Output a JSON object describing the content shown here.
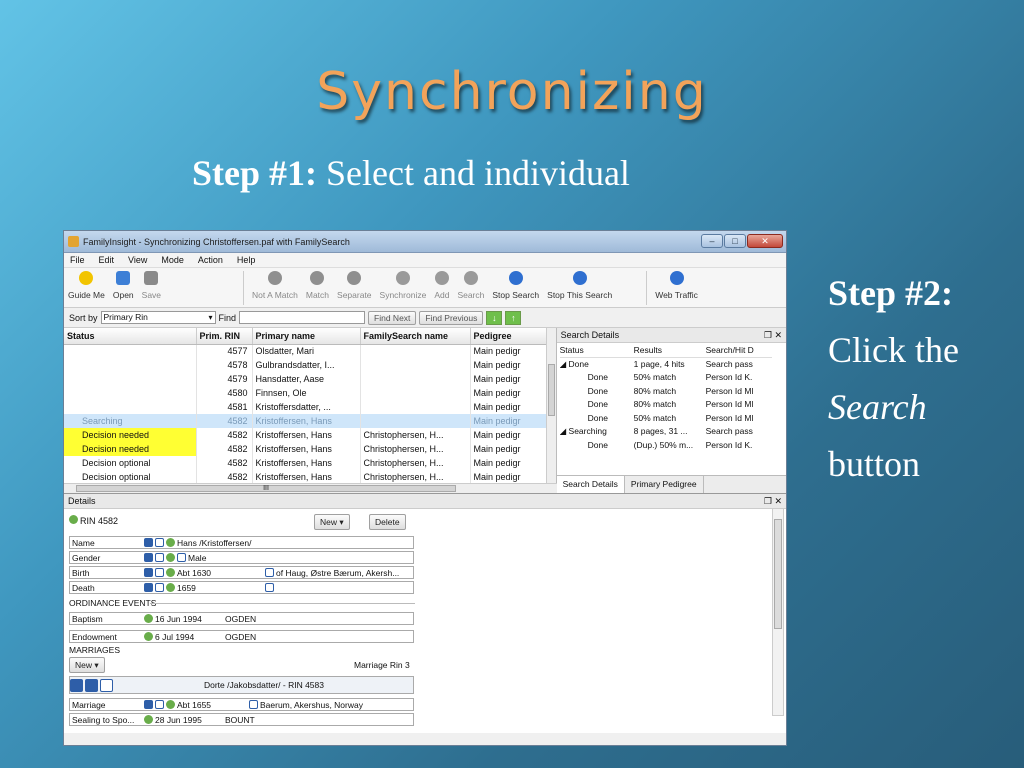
{
  "slide": {
    "title": "Synchronizing",
    "step1_bold": "Step #1:",
    "step1_text": " Select and individual",
    "step2_bold": "Step #2:",
    "step2_line1": "Click the",
    "step2_italic": "Search",
    "step2_line3": "button"
  },
  "window": {
    "title": "FamilyInsight - Synchronizing Christoffersen.paf with FamilySearch",
    "buttons": [
      "–",
      "□",
      "✕"
    ]
  },
  "menu": [
    "File",
    "Edit",
    "View",
    "Mode",
    "Action",
    "Help"
  ],
  "toolbar": {
    "group1": [
      {
        "label": "Guide Me",
        "icon": "lightbulb-icon",
        "color": "#f2c400"
      },
      {
        "label": "Open",
        "icon": "folder-icon",
        "color": "#3d7fd6"
      },
      {
        "label": "Save",
        "icon": "save-icon",
        "color": "#8a8a8a"
      }
    ],
    "group2": [
      {
        "label": "Not A Match",
        "icon": "people-x-icon",
        "color": "#8f8f8f"
      },
      {
        "label": "Match",
        "icon": "people-match-icon",
        "color": "#8f8f8f"
      },
      {
        "label": "Separate",
        "icon": "separate-icon",
        "color": "#8f8f8f"
      },
      {
        "label": "Synchronize",
        "icon": "sync-icon",
        "color": "#9a9a9a"
      },
      {
        "label": "Add",
        "icon": "add-person-icon",
        "color": "#9a9a9a"
      },
      {
        "label": "Search",
        "icon": "search-icon",
        "color": "#9a9a9a"
      },
      {
        "label": "Stop Search",
        "icon": "globe-stop-icon",
        "color": "#2f6fd0"
      },
      {
        "label": "Stop This Search",
        "icon": "globe-stop-this-icon",
        "color": "#2f6fd0"
      }
    ],
    "group3": [
      {
        "label": "Web Traffic",
        "icon": "globe-traffic-icon",
        "color": "#2f6fd0"
      }
    ]
  },
  "sortbar": {
    "sort_label": "Sort by",
    "sort_value": "Primary Rin",
    "find_label": "Find",
    "find_next": "Find Next",
    "find_previous": "Find Previous",
    "down_arrow": "↓",
    "up_arrow": "↑"
  },
  "grid": {
    "headers": [
      "Status",
      "Prim. RIN",
      "Primary name",
      "FamilySearch name",
      "Pedigree"
    ],
    "rows": [
      {
        "status": "",
        "rin": "4577",
        "primary": "Olsdatter, Mari",
        "fs": "",
        "pedigree": "Main pedigr"
      },
      {
        "status": "",
        "rin": "4578",
        "primary": "Gulbrandsdatter, I...",
        "fs": "",
        "pedigree": "Main pedigr"
      },
      {
        "status": "",
        "rin": "4579",
        "primary": "Hansdatter, Aase",
        "fs": "",
        "pedigree": "Main pedigr"
      },
      {
        "status": "",
        "rin": "4580",
        "primary": "Finnsen, Ole",
        "fs": "",
        "pedigree": "Main pedigr"
      },
      {
        "status": "",
        "rin": "4581",
        "primary": "Kristoffersdatter, ...",
        "fs": "",
        "pedigree": "Main pedigr"
      },
      {
        "status": "Searching",
        "rin": "4582",
        "primary": "Kristoffersen, Hans",
        "fs": "",
        "pedigree": "Main pedigr"
      },
      {
        "status": "Decision needed",
        "rin": "4582",
        "primary": "Kristoffersen, Hans",
        "fs": "Christophersen, H...",
        "pedigree": "Main pedigr"
      },
      {
        "status": "Decision needed",
        "rin": "4582",
        "primary": "Kristoffersen, Hans",
        "fs": "Christophersen, H...",
        "pedigree": "Main pedigr"
      },
      {
        "status": "Decision optional",
        "rin": "4582",
        "primary": "Kristoffersen, Hans",
        "fs": "Christophersen, H...",
        "pedigree": "Main pedigr"
      },
      {
        "status": "Decision optional",
        "rin": "4582",
        "primary": "Kristoffersen, Hans",
        "fs": "Christophersen, H...",
        "pedigree": "Main pedigr"
      }
    ],
    "hscroll_marker": "III"
  },
  "search_details": {
    "title": "Search Details",
    "controls": "❐ ✕",
    "headers": [
      "Status",
      "Results",
      "Search/Hit D"
    ],
    "rows": [
      {
        "status": "◢ Done",
        "results": "1 page, 4 hits",
        "hit": "Search pass"
      },
      {
        "status": "Done",
        "results": "50% match",
        "hit": "Person Id K."
      },
      {
        "status": "Done",
        "results": "80% match",
        "hit": "Person Id Ml"
      },
      {
        "status": "Done",
        "results": "80% match",
        "hit": "Person Id Ml"
      },
      {
        "status": "Done",
        "results": "50% match",
        "hit": "Person Id Ml"
      },
      {
        "status": "◢ Searching",
        "results": "8 pages, 31 ...",
        "hit": "Search pass"
      },
      {
        "status": "Done",
        "results": "(Dup.) 50% m...",
        "hit": "Person Id K."
      }
    ],
    "tabs": [
      "Search Details",
      "Primary Pedigree"
    ]
  },
  "details": {
    "title": "Details",
    "rin": "RIN 4582",
    "new_button": "New",
    "delete_button": "Delete",
    "fields": [
      {
        "label": "Name",
        "value": "Hans /Kristoffersen/",
        "place": ""
      },
      {
        "label": "Gender",
        "value": "Male",
        "place": ""
      },
      {
        "label": "Birth",
        "value": "Abt 1630",
        "place": "of Haug, Østre Bærum, Akersh..."
      },
      {
        "label": "Death",
        "value": "1659",
        "place": ""
      }
    ],
    "ordinance_title": "ORDINANCE EVENTS",
    "ordinances": [
      {
        "label": "Baptism",
        "date": "16 Jun 1994",
        "temple": "OGDEN"
      },
      {
        "label": "Endowment",
        "date": "6 Jul 1994",
        "temple": "OGDEN"
      }
    ],
    "marriages_title": "MARRIAGES",
    "marriage_new": "New",
    "marriage_rin": "Marriage Rin 3",
    "spouse": "Dorte /Jakobsdatter/ - RIN 4583",
    "marriage_rows": [
      {
        "label": "Marriage",
        "date": "Abt 1655",
        "place": "Baerum, Akershus, Norway"
      },
      {
        "label": "Sealing to Spo...",
        "date": "28 Jun 1995",
        "place": "BOUNT"
      }
    ]
  }
}
